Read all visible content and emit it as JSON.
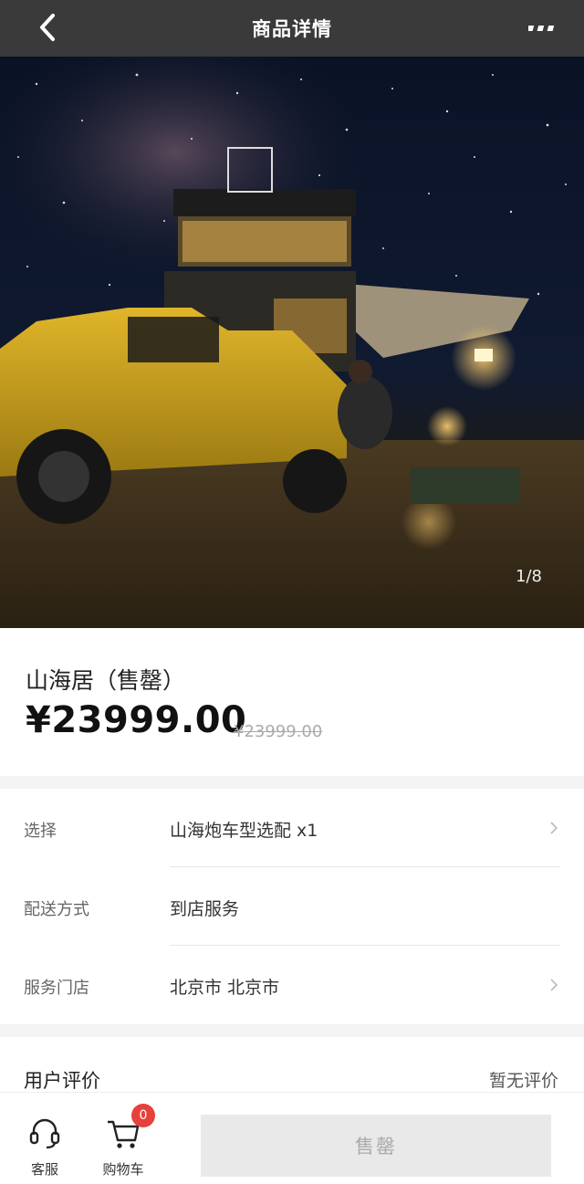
{
  "header": {
    "title": "商品详情"
  },
  "gallery": {
    "counter": "1/8"
  },
  "product": {
    "name": "山海居（售罄）",
    "price": "¥23999.00",
    "original_price": "¥23999.00"
  },
  "options": {
    "select": {
      "label": "选择",
      "value": "山海炮车型选配 x1"
    },
    "delivery": {
      "label": "配送方式",
      "value": "到店服务"
    },
    "store": {
      "label": "服务门店",
      "value": "北京市 北京市"
    }
  },
  "review": {
    "label": "用户评价",
    "status": "暂无评价"
  },
  "bottom_bar": {
    "service_label": "客服",
    "cart_label": "购物车",
    "cart_count": "0",
    "buy_label": "售罄"
  },
  "colors": {
    "header_bg": "#3a3a3a",
    "badge": "#e6413c",
    "disabled_button": "#e9e9e9"
  }
}
